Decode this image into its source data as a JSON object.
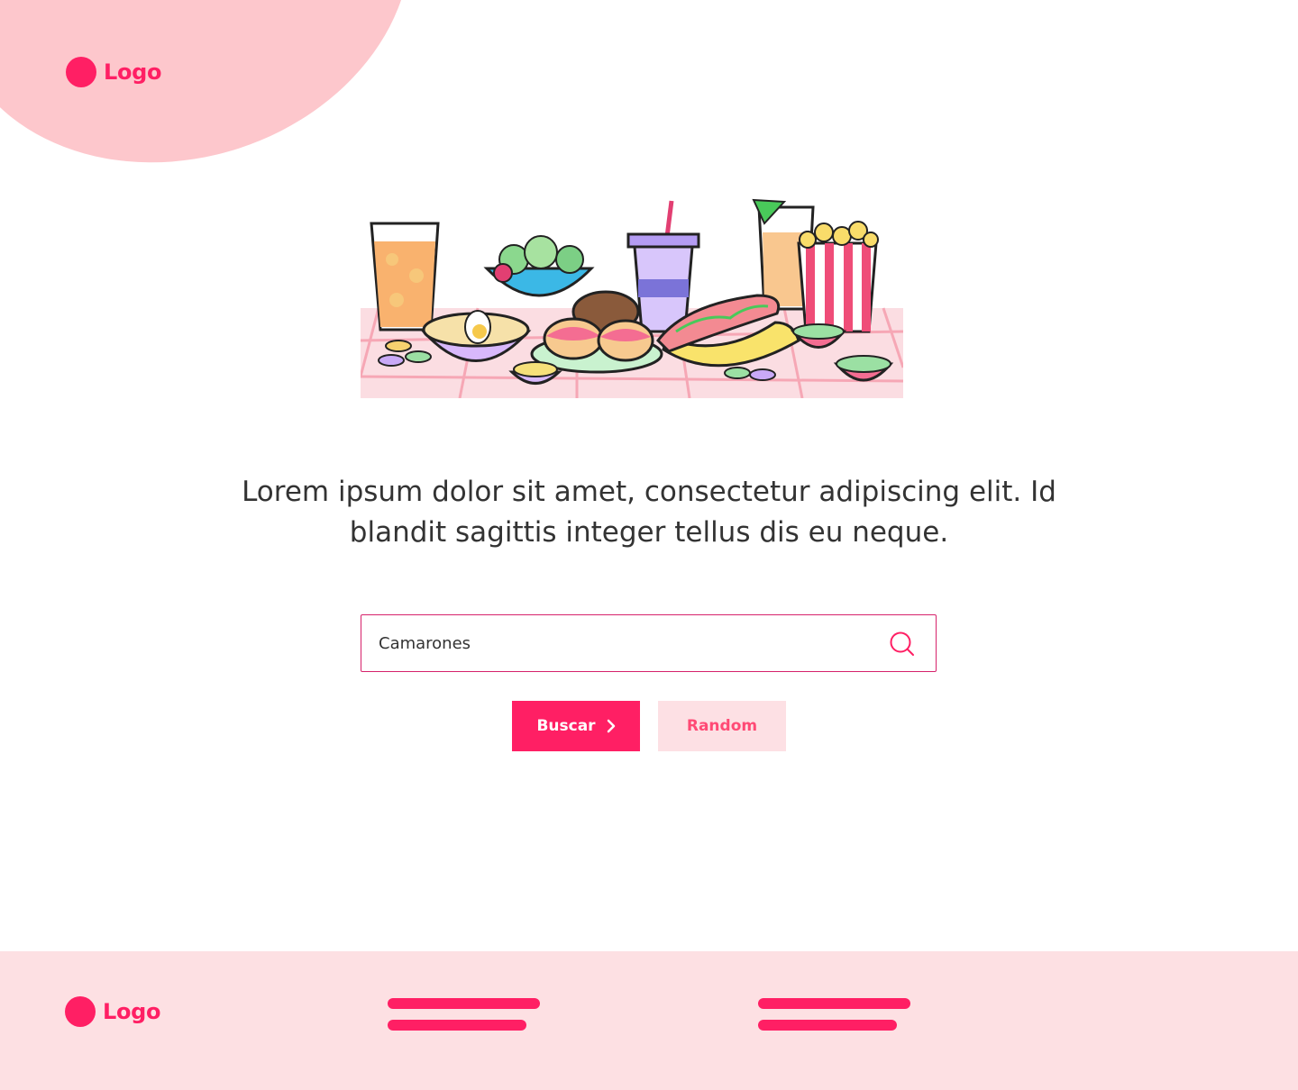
{
  "header": {
    "logo_text": "Logo"
  },
  "hero": {
    "illustration": "food-party-illustration",
    "text": "Lorem ipsum dolor sit amet, consectetur adipiscing elit. Id blandit sagittis integer tellus dis eu neque."
  },
  "search": {
    "value": "Camarones",
    "icon": "search-icon"
  },
  "buttons": {
    "search_label": "Buscar",
    "random_label": "Random"
  },
  "footer": {
    "logo_text": "Logo"
  },
  "colors": {
    "brand": "#ff1f64",
    "blob": "#fdc7cc",
    "footer_bg": "#fde0e3",
    "secondary_button_bg": "#fde0e4"
  }
}
